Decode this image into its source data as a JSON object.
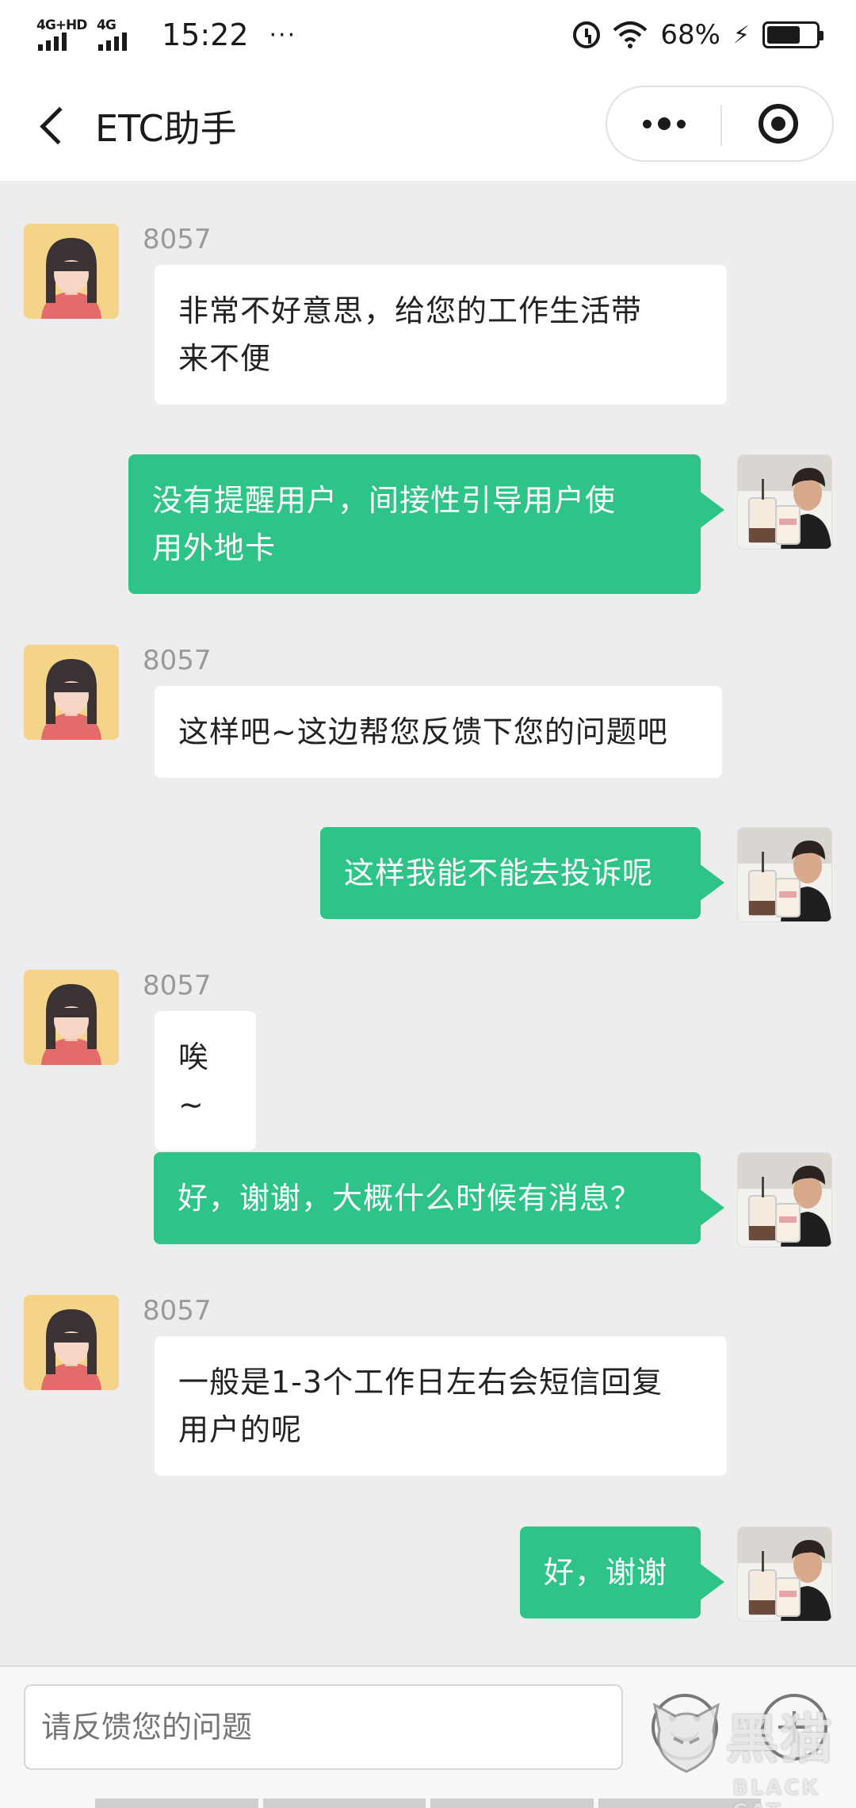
{
  "status_bar": {
    "network1": "4G+HD",
    "network2": "4G",
    "time": "15:22",
    "dots": "···",
    "battery_percent": "68%",
    "battery_level": 0.68
  },
  "nav": {
    "title": "ETC助手"
  },
  "messages": [
    {
      "side": "left",
      "sender": "8057",
      "lines": [
        "非常不好意思，给您的工作生活带",
        "来不便"
      ]
    },
    {
      "side": "right",
      "lines": [
        "没有提醒用户，间接性引导用户使",
        "用外地卡"
      ]
    },
    {
      "side": "left",
      "sender": "8057",
      "lines": [
        "这样吧~这边帮您反馈下您的问题吧"
      ]
    },
    {
      "side": "right",
      "lines": [
        "这样我能不能去投诉呢"
      ]
    },
    {
      "side": "left",
      "sender": "8057",
      "lines": [
        "唉~"
      ]
    },
    {
      "side": "right",
      "lines": [
        "好，谢谢，大概什么时候有消息？"
      ]
    },
    {
      "side": "left",
      "sender": "8057",
      "lines": [
        "一般是1-3个工作日左右会短信回复",
        "用户的呢"
      ]
    },
    {
      "side": "right",
      "lines": [
        "好，谢谢"
      ]
    }
  ],
  "input": {
    "placeholder": "请反馈您的问题"
  },
  "watermark": {
    "big": "黑猫",
    "small": "BLACK CAT"
  },
  "colors": {
    "accent_green": "#2fc487",
    "background": "#ededed"
  },
  "icons": {
    "back": "chevron-left-icon",
    "more": "more-dots-icon",
    "close": "target-close-icon",
    "emoji": "emoji-icon",
    "plus": "plus-icon"
  }
}
